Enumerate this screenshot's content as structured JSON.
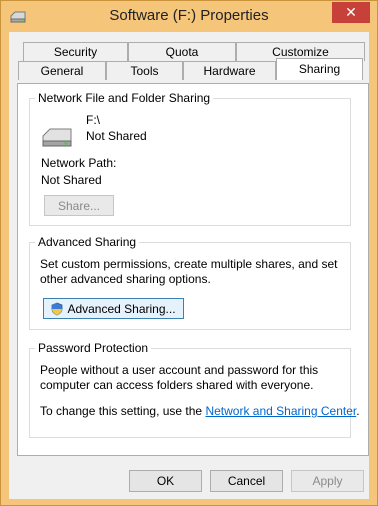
{
  "window": {
    "title": "Software (F:) Properties",
    "close_glyph": "✕"
  },
  "tabs": {
    "row1": [
      "Security",
      "Quota",
      "Customize"
    ],
    "row2": [
      "General",
      "Tools",
      "Hardware",
      "Sharing"
    ],
    "active": "Sharing"
  },
  "network_sharing": {
    "group_title": "Network File and Folder Sharing",
    "drive_label": "F:\\",
    "drive_status": "Not Shared",
    "path_label": "Network Path:",
    "path_value": "Not Shared",
    "share_button": "Share..."
  },
  "advanced_sharing": {
    "group_title": "Advanced Sharing",
    "description": "Set custom permissions, create multiple shares, and set other advanced sharing options.",
    "button": "Advanced Sharing..."
  },
  "password_protection": {
    "group_title": "Password Protection",
    "description": "People without a user account and password for this computer can access folders shared with everyone.",
    "change_prefix": "To change this setting, use the ",
    "link_text": "Network and Sharing Center",
    "change_suffix": "."
  },
  "footer": {
    "ok": "OK",
    "cancel": "Cancel",
    "apply": "Apply"
  },
  "colors": {
    "title_bar": "#f5c57a",
    "close_button": "#c7403a",
    "link": "#0066cc"
  }
}
